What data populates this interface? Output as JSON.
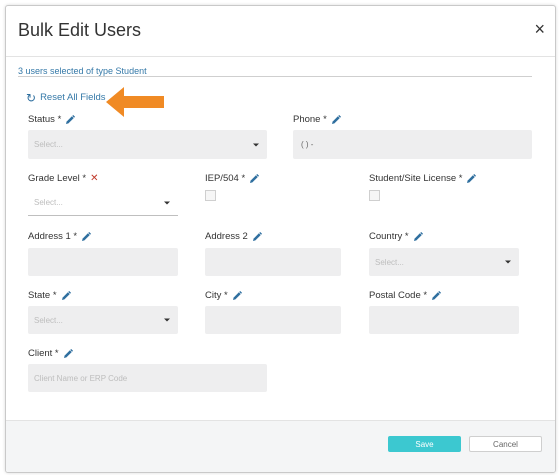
{
  "modal": {
    "title": "Bulk Edit Users",
    "close_glyph": "×",
    "selected_text": "3 users selected of type Student",
    "reset_label": "Reset All Fields",
    "reset_icon_glyph": "↻"
  },
  "fields": {
    "status": {
      "label": "Status *",
      "placeholder": "Select..."
    },
    "phone": {
      "label": "Phone *",
      "value": "(  )  -"
    },
    "grade_level": {
      "label": "Grade Level *",
      "placeholder": "Select..."
    },
    "iep": {
      "label": "IEP/504 *"
    },
    "license": {
      "label": "Student/Site License *"
    },
    "address1": {
      "label": "Address 1 *"
    },
    "address2": {
      "label": "Address 2"
    },
    "country": {
      "label": "Country *",
      "placeholder": "Select..."
    },
    "state": {
      "label": "State *",
      "placeholder": "Select..."
    },
    "city": {
      "label": "City *"
    },
    "postal": {
      "label": "Postal Code *"
    },
    "client": {
      "label": "Client *",
      "placeholder": "Client Name or ERP Code"
    }
  },
  "footer": {
    "save_label": "Save",
    "cancel_label": "Cancel"
  },
  "colors": {
    "accent": "#3cc8d0",
    "link": "#3579a8",
    "arrow": "#f08a24",
    "invalid": "#c0392b",
    "field_bg": "#eeeeef"
  },
  "icons": {
    "edit": "pencil-icon",
    "invalid": "x-icon",
    "reset": "refresh-icon",
    "annotation": "arrow-left-icon"
  }
}
